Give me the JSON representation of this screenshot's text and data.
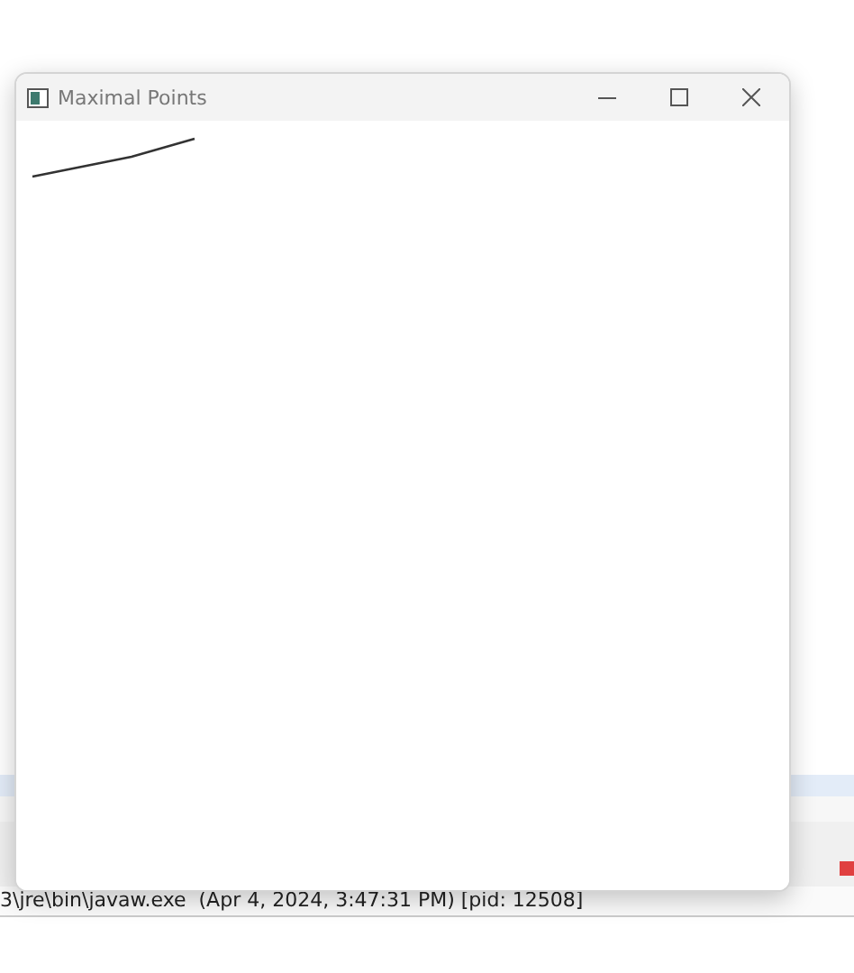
{
  "window": {
    "title": "Maximal Points"
  },
  "console": {
    "status_line": "3\\jre\\bin\\javaw.exe  (Apr 4, 2024, 3:47:31 PM) [pid: 12508]"
  }
}
